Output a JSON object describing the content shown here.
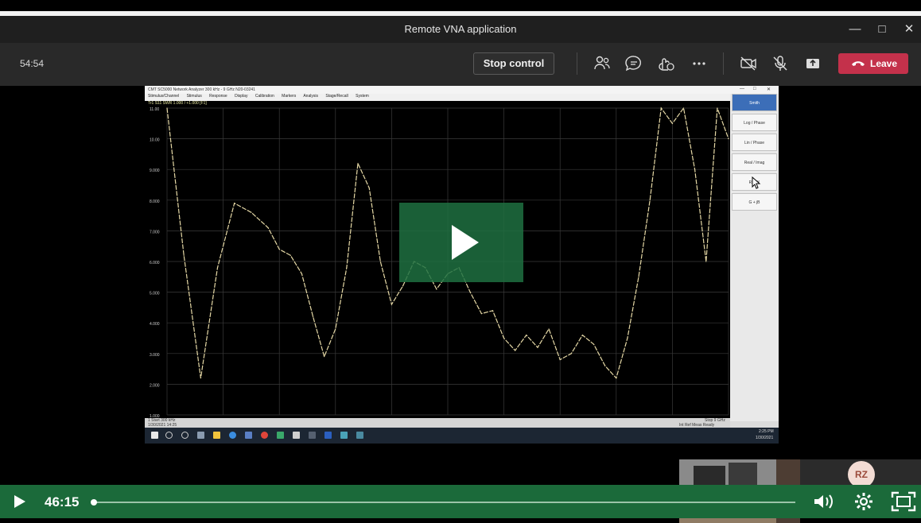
{
  "window": {
    "title": "Remote VNA application"
  },
  "meeting": {
    "elapsed": "54:54",
    "stop_control_label": "Stop control",
    "leave_label": "Leave",
    "leave_color": "#c4314b",
    "icons": [
      "people-icon",
      "chat-icon",
      "reactions-icon",
      "more-icon",
      "camera-off-icon",
      "mic-off-icon",
      "share-icon",
      "phone-icon"
    ]
  },
  "vna": {
    "title_text": "CMT  SC5000  Network Analyzer  300 kHz - 9 GHz  N20-03241",
    "menu": [
      "Stimulus/Channel",
      "Stimulus",
      "Response",
      "Display",
      "Calibration",
      "Markers",
      "Analysis",
      "Stage/Recall",
      "System"
    ],
    "trace_label": "Tr1  S11  SWR  1.000 / +1.000  [F1]",
    "y_ticks": [
      "11.00",
      "10.00",
      "9.000",
      "8.000",
      "7.000",
      "6.000",
      "5.000",
      "4.000",
      "3.000",
      "2.000",
      "1.000"
    ],
    "start_label": "1  Start 300 kHz",
    "stop_label": "Stop 9 GHz",
    "status_left": "1/30/2021  14:25",
    "status_right": "Int Ref  Meas  Ready",
    "side_buttons": [
      "Smith",
      "Log / Phase",
      "Lin / Phase",
      "Real / Imag",
      "R + jX",
      "G + jB"
    ],
    "taskbar_time": "2:25 PM",
    "taskbar_date": "1/30/2021"
  },
  "chart_data": {
    "type": "line",
    "title": "",
    "ylabel": "",
    "ylim": [
      1.0,
      11.0
    ],
    "x": [
      0.0,
      0.03,
      0.06,
      0.09,
      0.12,
      0.15,
      0.18,
      0.2,
      0.22,
      0.24,
      0.26,
      0.28,
      0.3,
      0.32,
      0.34,
      0.36,
      0.38,
      0.4,
      0.42,
      0.44,
      0.46,
      0.48,
      0.5,
      0.52,
      0.54,
      0.56,
      0.58,
      0.6,
      0.62,
      0.64,
      0.66,
      0.68,
      0.7,
      0.72,
      0.74,
      0.76,
      0.78,
      0.8,
      0.82,
      0.84,
      0.86,
      0.88,
      0.9,
      0.92,
      0.94,
      0.96,
      0.98,
      1.0
    ],
    "series": [
      {
        "values": [
          11,
          6.2,
          2.2,
          5.8,
          7.9,
          7.6,
          7.1,
          6.4,
          6.2,
          5.6,
          4.2,
          2.9,
          3.8,
          5.8,
          9.2,
          8.4,
          6.0,
          4.6,
          5.2,
          6.0,
          5.8,
          5.1,
          5.6,
          5.8,
          5.0,
          4.3,
          4.4,
          3.5,
          3.1,
          3.6,
          3.2,
          3.8,
          2.8,
          3.0,
          3.6,
          3.3,
          2.6,
          2.2,
          3.5,
          5.5,
          8.0,
          11,
          10.5,
          11,
          9.0,
          6.0,
          11,
          10.0
        ]
      }
    ],
    "grid": true
  },
  "player": {
    "current_time": "46:15",
    "progress_fraction": 0.0,
    "avatar_initials": "RZ",
    "avatar_color": "#f3dcd4"
  }
}
